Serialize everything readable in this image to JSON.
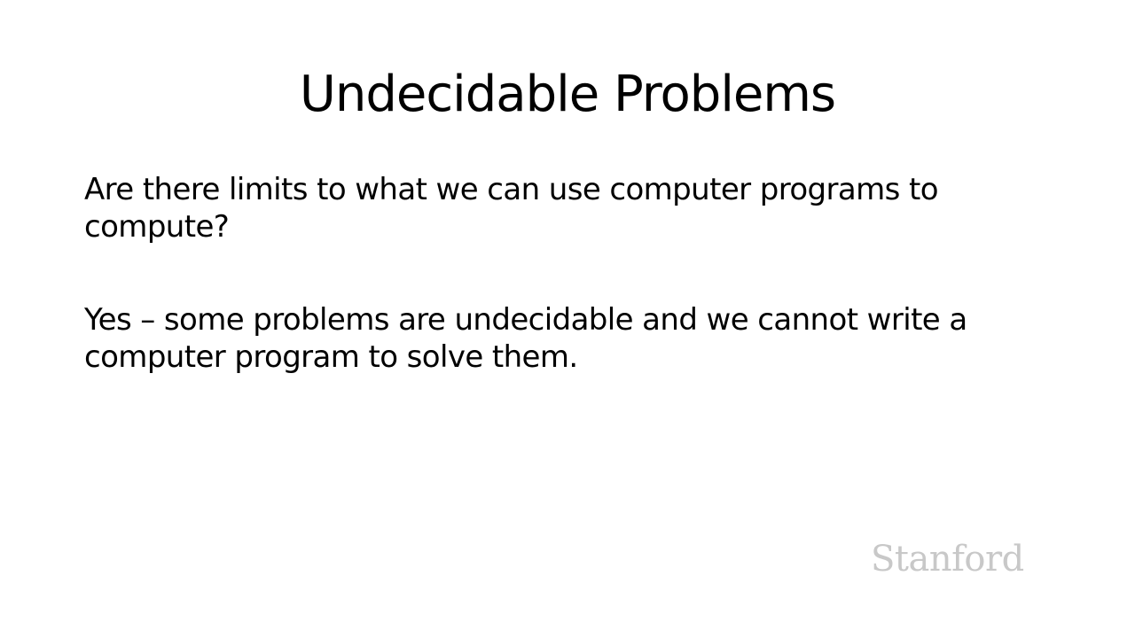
{
  "slide": {
    "title": "Undecidable Problems",
    "paragraphs": [
      "Are there limits to what we can use computer programs to compute?",
      "Yes – some problems are undecidable and we cannot write a computer program to solve them."
    ],
    "logo_text": "Stanford"
  }
}
